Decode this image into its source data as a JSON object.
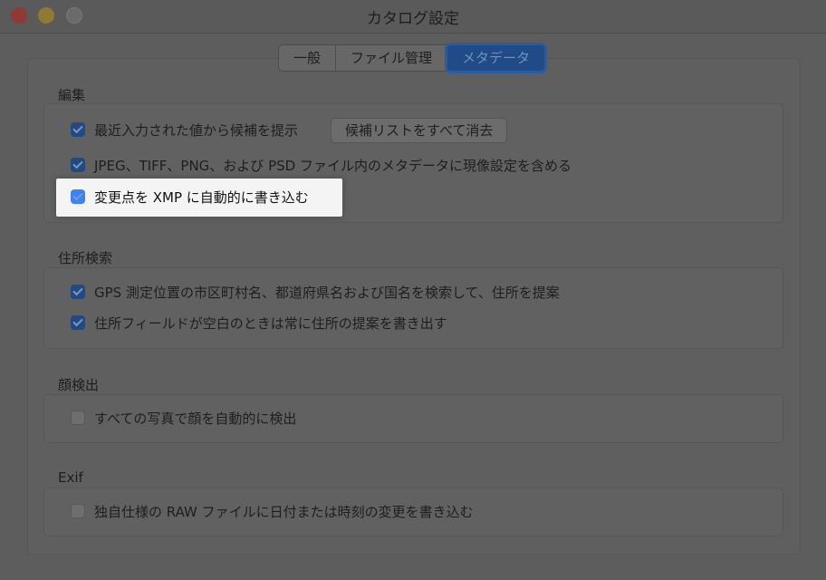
{
  "window": {
    "title": "カタログ設定",
    "traffic_colors": {
      "close": "#8e3a35",
      "minimize": "#8f7a33",
      "zoom": "#6b6b6b"
    }
  },
  "tabs": [
    {
      "label": "一般",
      "active": false
    },
    {
      "label": "ファイル管理",
      "active": false
    },
    {
      "label": "メタデータ",
      "active": true
    }
  ],
  "sections": {
    "editing": {
      "label": "編集",
      "items": [
        {
          "label": "最近入力された値から候補を提示",
          "checked": true
        },
        {
          "label": "JPEG、TIFF、PNG、および PSD ファイル内のメタデータに現像設定を含める",
          "checked": true
        },
        {
          "label": "変更点を XMP に自動的に書き込む",
          "checked": true,
          "highlighted": true
        }
      ],
      "clear_button": "候補リストをすべて消去"
    },
    "address": {
      "label": "住所検索",
      "items": [
        {
          "label": "GPS 測定位置の市区町村名、都道府県名および国名を検索して、住所を提案",
          "checked": true
        },
        {
          "label": "住所フィールドが空白のときは常に住所の提案を書き出す",
          "checked": true
        }
      ]
    },
    "face": {
      "label": "顔検出",
      "items": [
        {
          "label": "すべての写真で顔を自動的に検出",
          "checked": false
        }
      ]
    },
    "exif": {
      "label": "Exif",
      "items": [
        {
          "label": "独自仕様の RAW ファイルに日付または時刻の変更を書き込む",
          "checked": false
        }
      ]
    }
  },
  "colors": {
    "accent": "#3b82f6",
    "overlay": "#5d5d5d"
  }
}
